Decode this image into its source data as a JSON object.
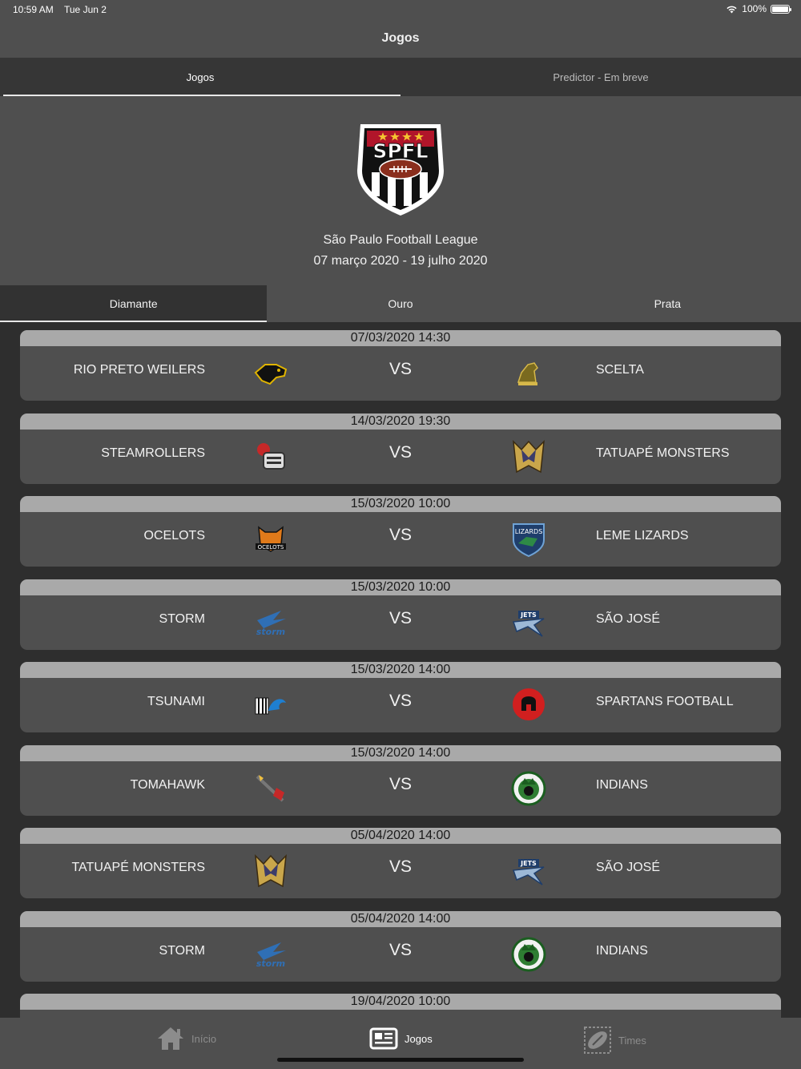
{
  "status": {
    "time": "10:59 AM",
    "date": "Tue Jun 2",
    "battery": "100%"
  },
  "nav": {
    "title": "Jogos"
  },
  "top_tabs": [
    {
      "label": "Jogos",
      "active": true
    },
    {
      "label": "Predictor - Em breve",
      "active": false
    }
  ],
  "league": {
    "logo_text": "SPFL",
    "name": "São Paulo Football League",
    "dates": "07 março 2020 - 19 julho 2020"
  },
  "division_tabs": [
    {
      "label": "Diamante",
      "active": true
    },
    {
      "label": "Ouro",
      "active": false
    },
    {
      "label": "Prata",
      "active": false
    }
  ],
  "vs_label": "VS",
  "games": [
    {
      "datetime": "07/03/2020 14:30",
      "home": "RIO PRETO WEILERS",
      "home_logo": "weilers-dog-logo",
      "away": "SCELTA",
      "away_logo": "scelta-horse-logo"
    },
    {
      "datetime": "14/03/2020 19:30",
      "home": "STEAMROLLERS",
      "home_logo": "steamrollers-logo",
      "away": "TATUAPÉ MONSTERS",
      "away_logo": "monsters-m-logo"
    },
    {
      "datetime": "15/03/2020 10:00",
      "home": "OCELOTS",
      "home_logo": "ocelots-cat-logo",
      "away": "LEME LIZARDS",
      "away_logo": "lizards-shield-logo"
    },
    {
      "datetime": "15/03/2020 10:00",
      "home": "STORM",
      "home_logo": "storm-logo",
      "away": "SÃO JOSÉ",
      "away_logo": "jets-logo"
    },
    {
      "datetime": "15/03/2020 14:00",
      "home": "TSUNAMI",
      "home_logo": "tsunami-wave-logo",
      "away": "SPARTANS FOOTBALL",
      "away_logo": "spartans-helmet-logo"
    },
    {
      "datetime": "15/03/2020 14:00",
      "home": "TOMAHAWK",
      "home_logo": "tomahawk-logo",
      "away": "INDIANS",
      "away_logo": "indians-logo"
    },
    {
      "datetime": "05/04/2020 14:00",
      "home": "TATUAPÉ MONSTERS",
      "home_logo": "monsters-m-logo",
      "away": "SÃO JOSÉ",
      "away_logo": "jets-logo"
    },
    {
      "datetime": "05/04/2020 14:00",
      "home": "STORM",
      "home_logo": "storm-logo",
      "away": "INDIANS",
      "away_logo": "indians-logo"
    },
    {
      "datetime": "19/04/2020 10:00",
      "home": "",
      "home_logo": "storm-logo",
      "away": "",
      "away_logo": ""
    }
  ],
  "tabbar": [
    {
      "label": "Início",
      "icon": "home-icon",
      "active": false
    },
    {
      "label": "Jogos",
      "icon": "news-icon",
      "active": true
    },
    {
      "label": "Times",
      "icon": "football-icon",
      "active": false
    }
  ]
}
